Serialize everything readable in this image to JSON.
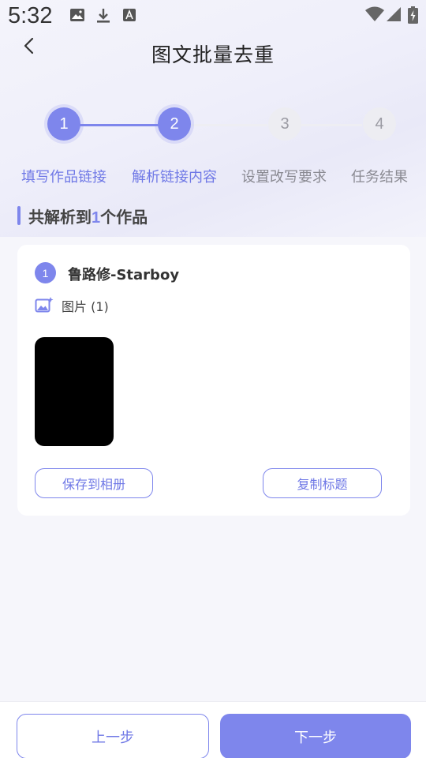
{
  "status_bar": {
    "time": "5:32",
    "icons": [
      "image-icon",
      "download-icon",
      "font-icon",
      "wifi-icon",
      "signal-icon",
      "battery-charging-icon"
    ]
  },
  "header": {
    "title": "图文批量去重",
    "back_icon": "chevron-left-icon"
  },
  "stepper": {
    "steps": [
      {
        "number": "1",
        "label": "填写作品链接",
        "state": "done"
      },
      {
        "number": "2",
        "label": "解析链接内容",
        "state": "current"
      },
      {
        "number": "3",
        "label": "设置改写要求",
        "state": "pending"
      },
      {
        "number": "4",
        "label": "任务结果",
        "state": "pending"
      }
    ],
    "accent_color": "#7e86ec"
  },
  "section": {
    "prefix": "共解析到",
    "count": "1",
    "suffix": "个作品"
  },
  "card": {
    "index": "1",
    "title": "鲁路修-Starboy",
    "images_label": "图片 (1)",
    "save_button": "保存到相册",
    "copy_button": "复制标题"
  },
  "footer": {
    "prev_button": "上一步",
    "next_button": "下一步"
  },
  "colors": {
    "accent": "#7e86ec",
    "background": "#f6f6fb"
  }
}
